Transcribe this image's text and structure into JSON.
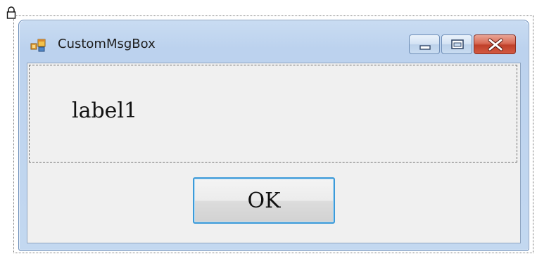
{
  "window": {
    "title": "CustomMsgBox",
    "caption_buttons": [
      "minimize",
      "maximize",
      "close"
    ]
  },
  "icons": {
    "app": "form-icon",
    "lock": "lock-icon",
    "minimize": "minimize-icon",
    "maximize": "maximize-icon",
    "close": "close-icon"
  },
  "content": {
    "message_label": "label1",
    "ok_button_label": "OK"
  },
  "colors": {
    "title_bar": "#bcd2ee",
    "client_background": "#f0f0f0",
    "close_button": "#c0402a",
    "ok_button_border": "#3c9ad8"
  }
}
